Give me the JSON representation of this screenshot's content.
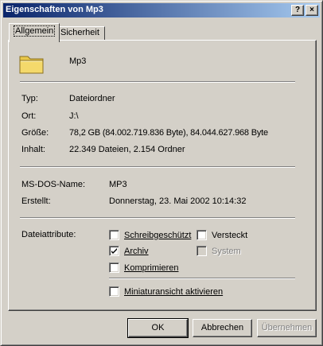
{
  "window": {
    "title": "Eigenschaften von Mp3",
    "help_label": "?",
    "close_label": "×"
  },
  "tabs": [
    {
      "label": "Allgemein",
      "active": true
    },
    {
      "label": "Sicherheit",
      "active": false
    }
  ],
  "folder": {
    "icon": "folder-icon",
    "name": "Mp3"
  },
  "properties": [
    {
      "label": "Typ:",
      "value": "Dateiordner"
    },
    {
      "label": "Ort:",
      "value": "J:\\"
    },
    {
      "label": "Größe:",
      "value": "78,2 GB (84.002.719.836 Byte), 84.044.627.968 Byte"
    },
    {
      "label": "Inhalt:",
      "value": "22.349 Dateien, 2.154 Ordner"
    }
  ],
  "dos": {
    "label": "MS-DOS-Name:",
    "value": "MP3"
  },
  "created": {
    "label": "Erstellt:",
    "value": "Donnerstag, 23. Mai 2002 10:14:32"
  },
  "attributes": {
    "label": "Dateiattribute:",
    "items": [
      {
        "label": "Schreibgeschützt",
        "checked": false,
        "disabled": false
      },
      {
        "label": "Versteckt",
        "checked": false,
        "disabled": false
      },
      {
        "label": "Archiv",
        "checked": true,
        "disabled": false
      },
      {
        "label": "System",
        "checked": false,
        "disabled": true
      },
      {
        "label": "Komprimieren",
        "checked": false,
        "disabled": false
      }
    ]
  },
  "thumbnail": {
    "label": "Miniaturansicht aktivieren",
    "checked": false
  },
  "buttons": {
    "ok": "OK",
    "cancel": "Abbrechen",
    "apply": "Übernehmen"
  },
  "colors": {
    "titlebar_start": "#0a246a",
    "titlebar_end": "#a6caf0",
    "face": "#d4d0c8",
    "folder": "#f4d96b"
  }
}
